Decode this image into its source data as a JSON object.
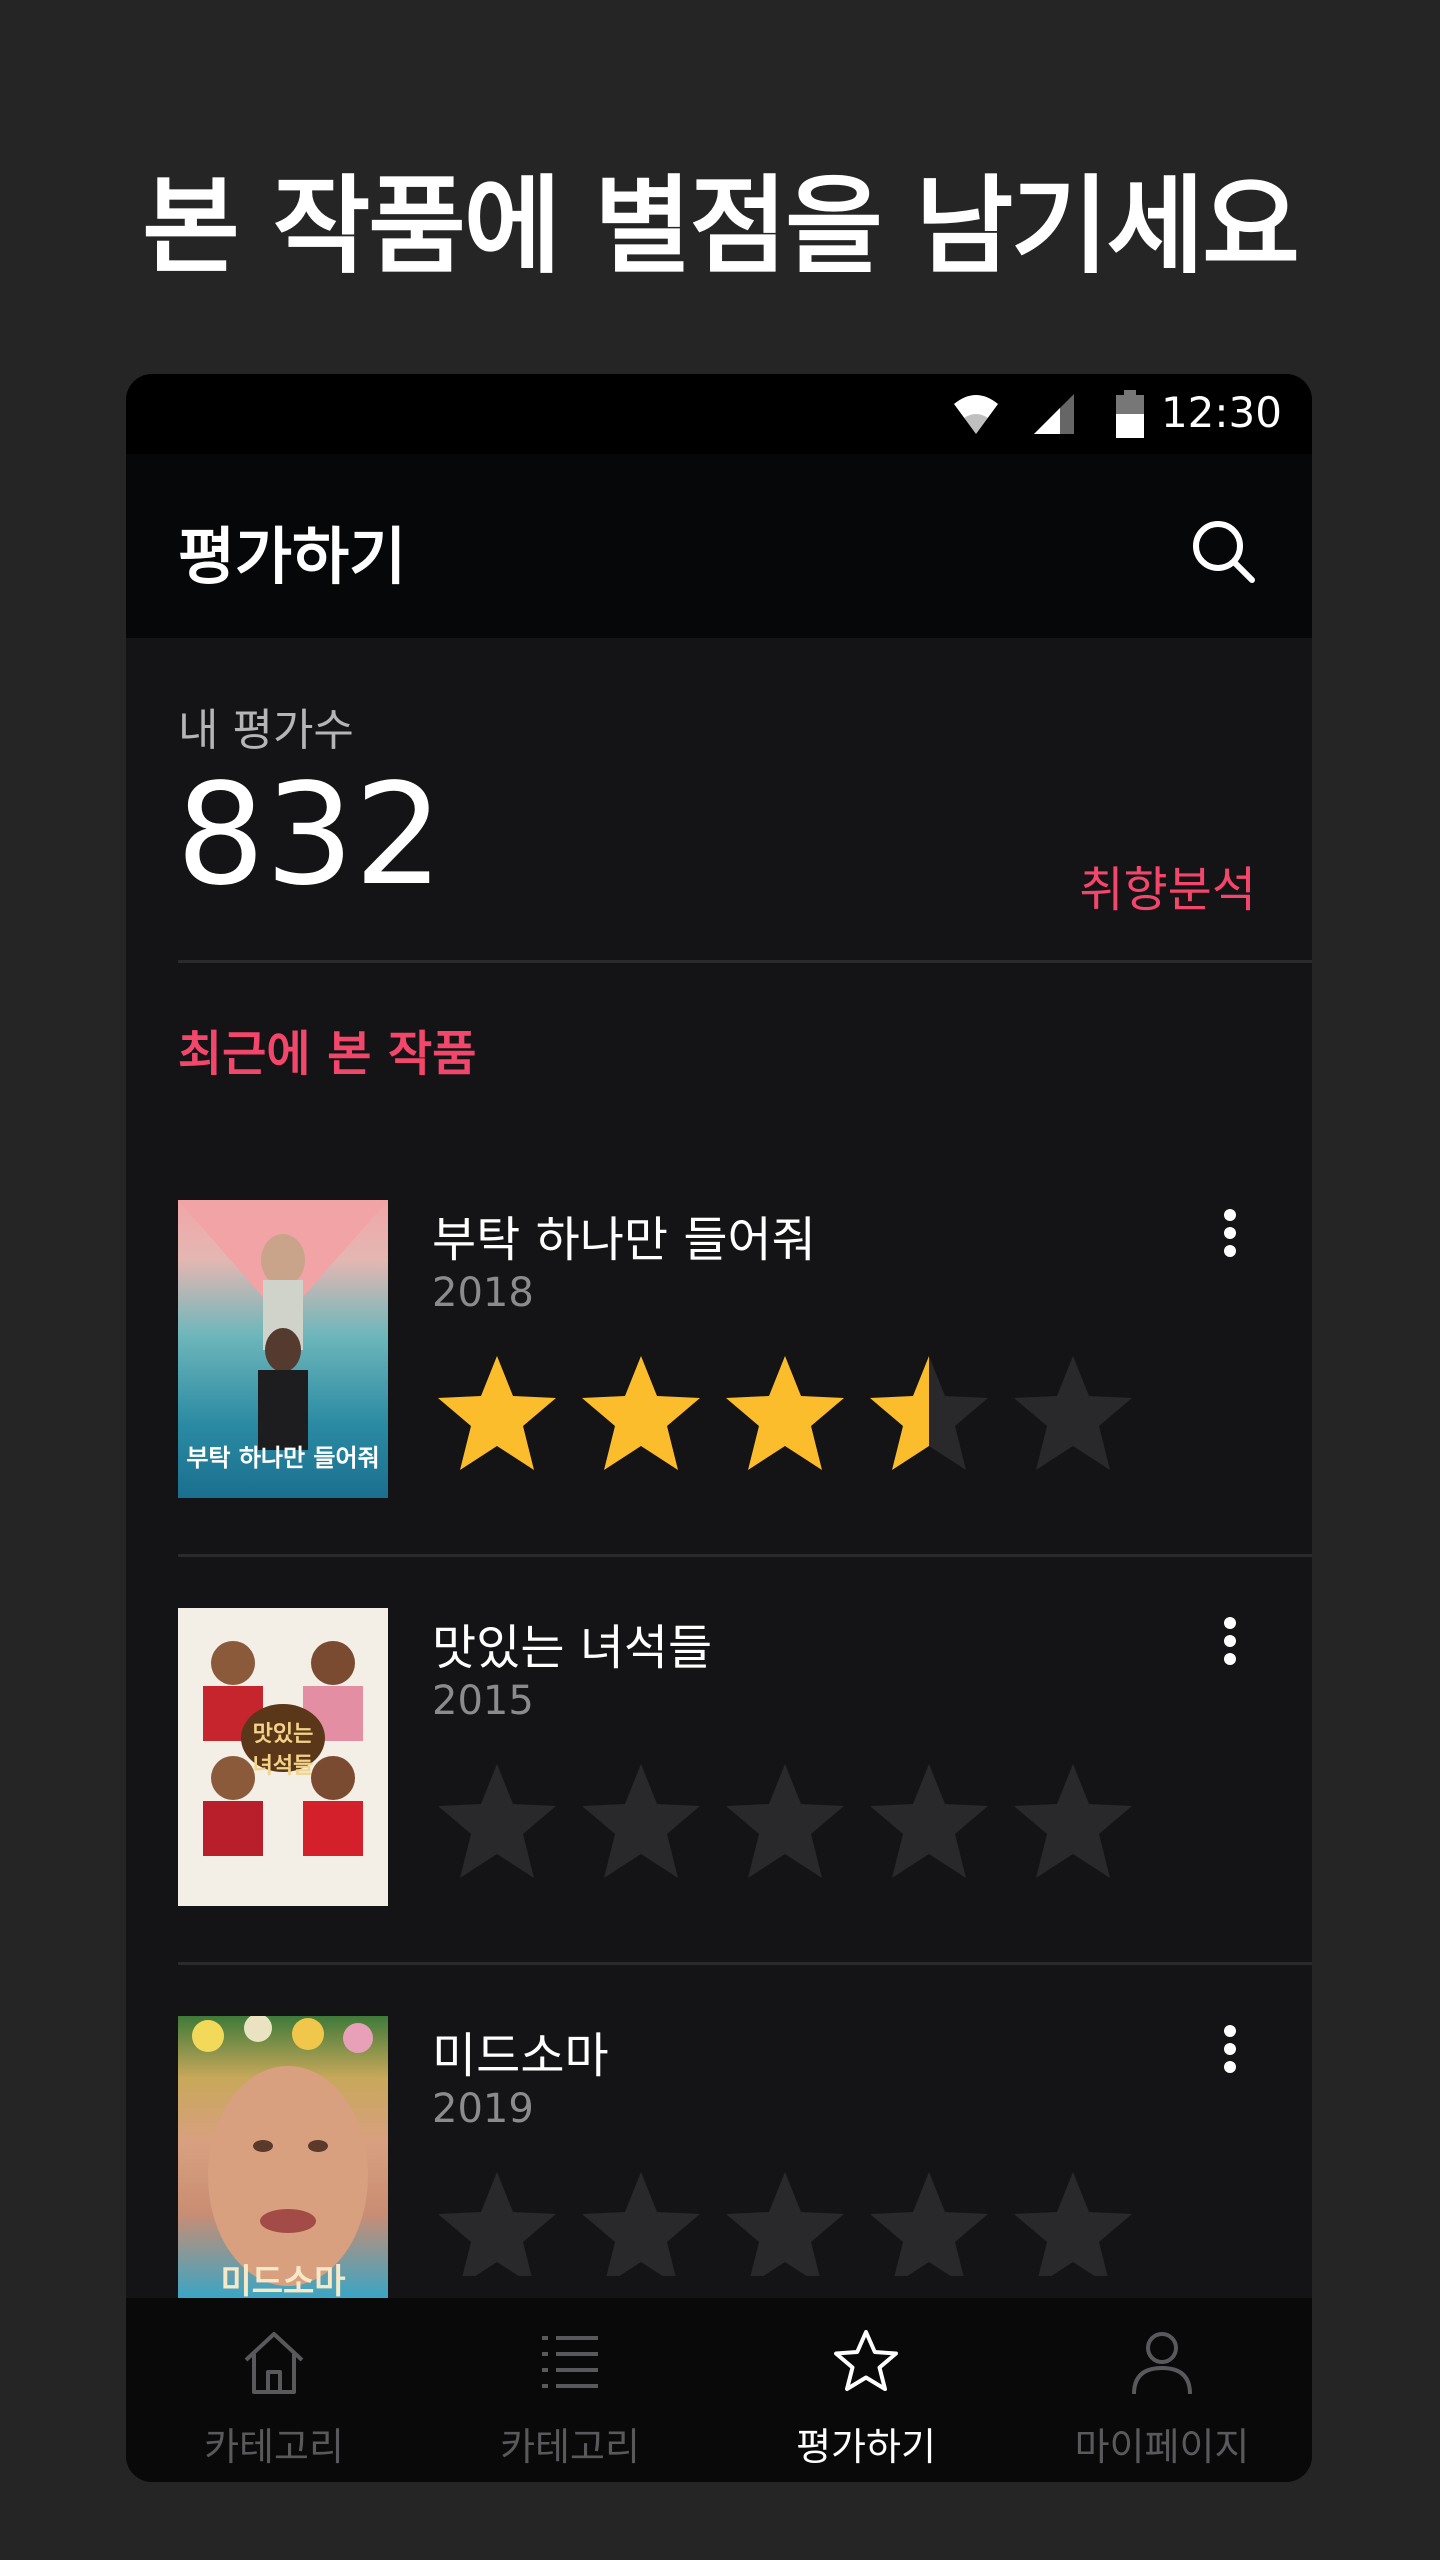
{
  "headline": "본 작품에 별점을 남기세요",
  "status": {
    "time": "12:30"
  },
  "appbar": {
    "title": "평가하기",
    "search_icon": "search-icon"
  },
  "summary": {
    "label": "내 평가수",
    "count": "832",
    "taste_link": "취향분석"
  },
  "recent": {
    "title": "최근에 본 작품",
    "items": [
      {
        "title": "부탁 하나만 들어줘",
        "year": "2018",
        "rating": 3.5,
        "poster_text": "부탁 하나만 들어줘"
      },
      {
        "title": "맛있는 녀석들",
        "year": "2015",
        "rating": 0,
        "poster_text": "맛있는 녀석들"
      },
      {
        "title": "미드소마",
        "year": "2019",
        "rating": 0,
        "poster_text": "미드소마"
      }
    ]
  },
  "nav": {
    "items": [
      {
        "label": "카테고리",
        "icon": "home-icon",
        "active": false
      },
      {
        "label": "카테고리",
        "icon": "list-icon",
        "active": false
      },
      {
        "label": "평가하기",
        "icon": "star-icon",
        "active": true
      },
      {
        "label": "마이페이지",
        "icon": "person-icon",
        "active": false
      }
    ]
  },
  "colors": {
    "accent": "#f2466b",
    "star_filled": "#fbbd2b",
    "star_empty": "#29292c",
    "background": "#252526"
  }
}
